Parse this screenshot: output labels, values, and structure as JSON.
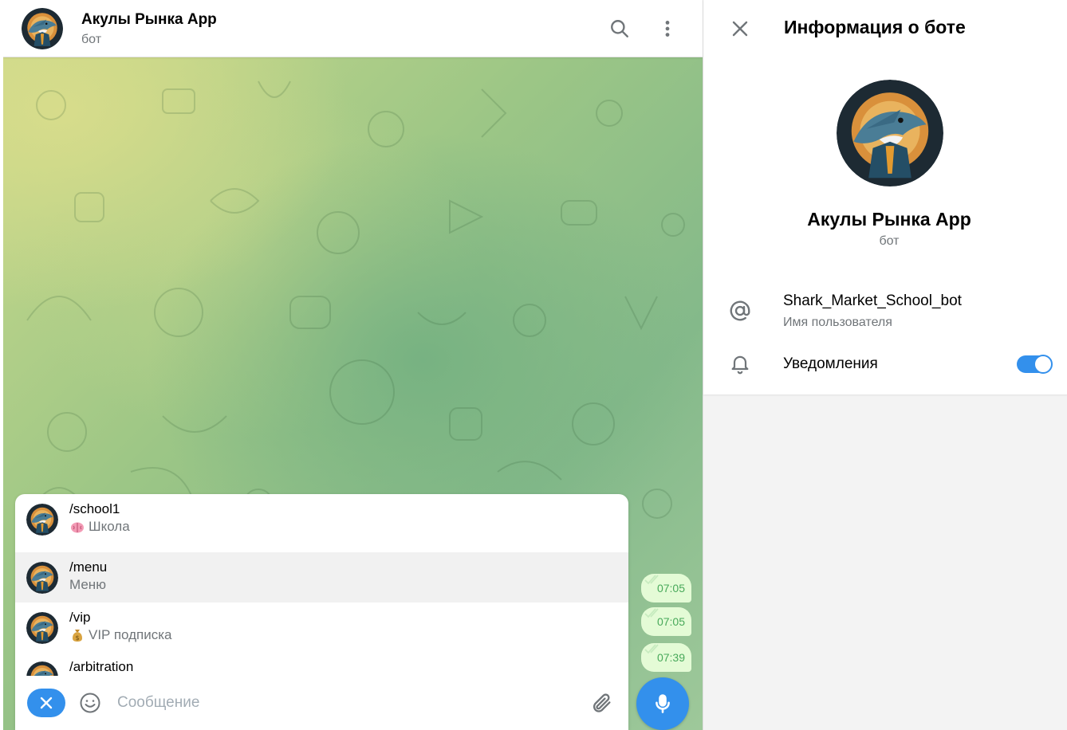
{
  "chat": {
    "title": "Акулы Рынка App",
    "subtitle": "бот",
    "icons": {
      "search": "search-icon",
      "menu": "more-vertical-icon"
    },
    "messages": [
      {
        "time": "07:05"
      },
      {
        "time": "07:05"
      },
      {
        "time": "07:39"
      }
    ]
  },
  "commands": [
    {
      "name": "/school1",
      "emoji": "brain-emoji",
      "desc": "Школа"
    },
    {
      "name": "/menu",
      "emoji": "",
      "desc": "Меню"
    },
    {
      "name": "/vip",
      "emoji": "money-bag-emoji",
      "desc": "VIP подписка"
    },
    {
      "name": "/arbitration",
      "emoji": "",
      "desc": ""
    }
  ],
  "composer": {
    "placeholder": "Сообщение",
    "icons": {
      "close": "close-icon",
      "emoji": "smiley-icon",
      "attach": "paperclip-icon",
      "mic": "microphone-icon"
    }
  },
  "info": {
    "title": "Информация о боте",
    "name": "Акулы Рынка App",
    "subtitle": "бот",
    "username": "Shark_Market_School_bot",
    "username_label": "Имя пользователя",
    "notifications_label": "Уведомления",
    "notifications_enabled": true
  },
  "colors": {
    "accent": "#3390ec",
    "bubble": "#e4fbd6",
    "time": "#48a95a"
  }
}
